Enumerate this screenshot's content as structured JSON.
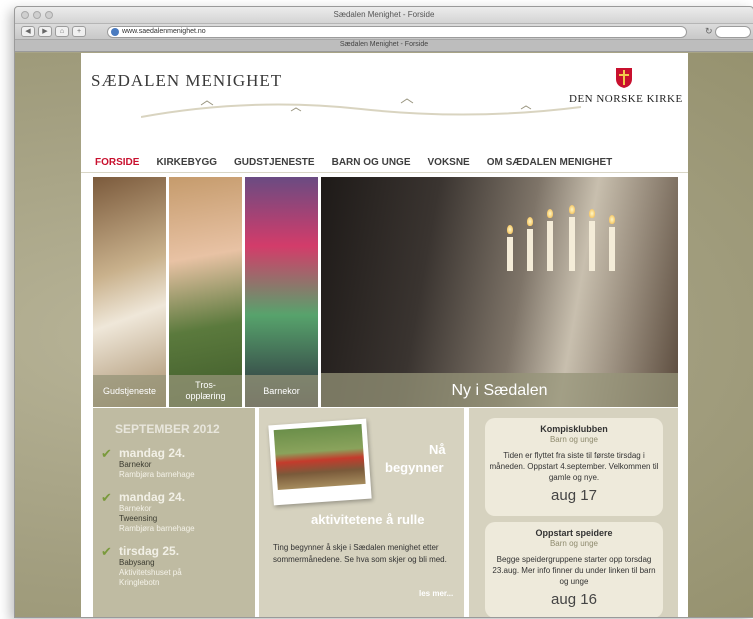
{
  "window": {
    "title": "Sædalen Menighet - Forside",
    "url": "www.saedalenmenighet.no",
    "tab_title": "Sædalen Menighet - Forside"
  },
  "header": {
    "logo_left": "SÆDALEN MENIGHET",
    "logo_right": "DEN NORSKE KIRKE"
  },
  "menu": {
    "items": [
      "FORSIDE",
      "KIRKEBYGG",
      "GUDSTJENESTE",
      "BARN OG UNGE",
      "VOKSNE",
      "OM SÆDALEN MENIGHET"
    ],
    "active": "FORSIDE"
  },
  "hero": {
    "tiles": [
      "Gudstjeneste",
      "Tros-\nopplæring",
      "Barnekor",
      "Ny i Sædalen"
    ]
  },
  "calendar": {
    "heading": "SEPTEMBER 2012",
    "events": [
      {
        "date": "mandag 24.",
        "lines": [
          "Barnekor",
          "Rambjøra barnehage"
        ]
      },
      {
        "date": "mandag 24.",
        "lines": [
          "Barnekor",
          "Tweensing",
          "Rambjøra barnehage"
        ]
      },
      {
        "date": "tirsdag 25.",
        "lines": [
          "Babysang",
          "Aktivitetshuset på",
          "Kringlebotn"
        ]
      }
    ]
  },
  "news": {
    "title_1": "Nå",
    "title_2": "begynner",
    "title_3": "aktivitetene å rulle",
    "body": "Ting begynner å skje i Sædalen menighet etter sommermånedene. Se hva som skjer og bli med.",
    "read_more": "les mer..."
  },
  "cards": [
    {
      "title": "Kompisklubben",
      "sub": "Barn og unge",
      "body": "Tiden er flyttet fra siste til første tirsdag i måneden. Oppstart 4.september. Velkommen til gamle og nye.",
      "date": "aug 17"
    },
    {
      "title": "Oppstart speidere",
      "sub": "Barn og unge",
      "body": "Begge speidergruppene starter opp torsdag 23.aug. Mer info finner du under linken til barn og unge",
      "date": "aug 16"
    }
  ],
  "colors": {
    "accent_red": "#c8102e",
    "background_olive": "#a8a486",
    "check_green": "#7a9a3c"
  }
}
